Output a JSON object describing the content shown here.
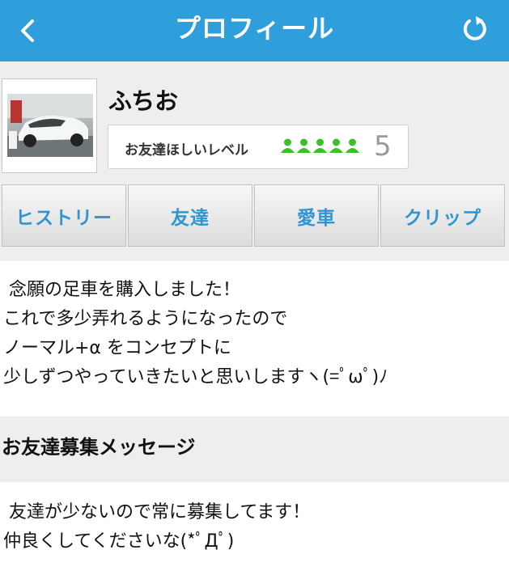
{
  "header": {
    "title": "プロフィール",
    "back_icon": "chevron-left-icon",
    "reload_icon": "reload-icon",
    "color": "#2f9fdb"
  },
  "profile": {
    "name": "ふちお",
    "avatar_alt": "white car photo",
    "level_label": "お友達ほしいレベル",
    "level_value": "5",
    "level_icon_color": "#3cbf2a",
    "level_icons_filled": 5
  },
  "tabs": [
    {
      "label": "ヒストリー"
    },
    {
      "label": "友達"
    },
    {
      "label": "愛車"
    },
    {
      "label": "クリップ"
    }
  ],
  "intro": {
    "lines": [
      " 念願の足車を購入しました！",
      "これで多少弄れるようになったので",
      "ノーマル+α をコンセプトに",
      "少しずつやっていきたいと思いしますヽ(=ﾟωﾟ)ﾉ"
    ]
  },
  "friend_message": {
    "title": "お友達募集メッセージ",
    "lines": [
      " 友達が少ないので常に募集してます！",
      "仲良くしてくださいな(*ﾟДﾟ)"
    ]
  }
}
